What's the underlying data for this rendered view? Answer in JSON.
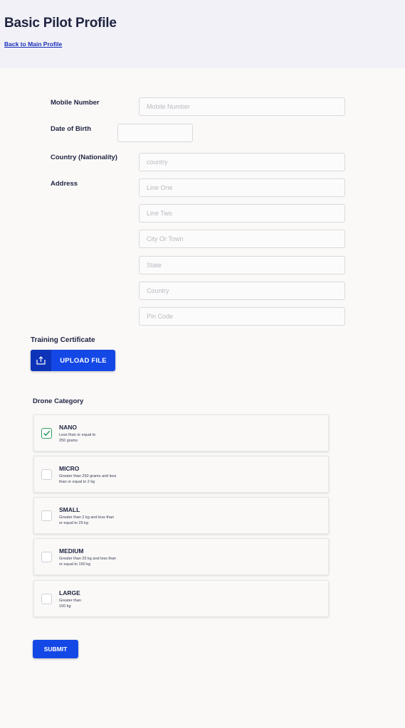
{
  "header": {
    "title": "Basic Pilot Profile",
    "back_link": "Back to Main Profile"
  },
  "form": {
    "mobile": {
      "label": "Mobile Number",
      "placeholder": "Mobile Number",
      "value": ""
    },
    "dob": {
      "label": "Date of Birth",
      "value": ""
    },
    "nationality": {
      "label": "Country (Nationality)",
      "placeholder": "country",
      "value": ""
    },
    "address": {
      "label": "Address",
      "line_one": {
        "placeholder": "Line One"
      },
      "line_two": {
        "placeholder": "Line Two"
      },
      "city": {
        "placeholder": "City Or Town"
      },
      "state": {
        "placeholder": "State"
      },
      "country": {
        "placeholder": "Country"
      },
      "pin": {
        "placeholder": "Pin Code"
      }
    }
  },
  "training": {
    "title": "Training Certificate",
    "upload_label": "UPLOAD FILE",
    "icon": "upload-icon"
  },
  "drone": {
    "title": "Drone Category",
    "categories": [
      {
        "name": "NANO",
        "description": "Less than or equal to 250 grams",
        "checked": true
      },
      {
        "name": "MICRO",
        "description": "Greater than 250 grams and less than or equal to 2 kg",
        "checked": false
      },
      {
        "name": "SMALL",
        "description": "Greater than 2 kg and less than or equal to 25 kg",
        "checked": false
      },
      {
        "name": "MEDIUM",
        "description": "Greater than 25 kg and less than or equal to 150 kg",
        "checked": false
      },
      {
        "name": "LARGE",
        "description": "Greater than 150 kg",
        "checked": false
      }
    ]
  },
  "submit_label": "SUBMIT",
  "colors": {
    "primary": "#1448e6",
    "check": "#2e9a5e",
    "title": "#1f2340"
  }
}
